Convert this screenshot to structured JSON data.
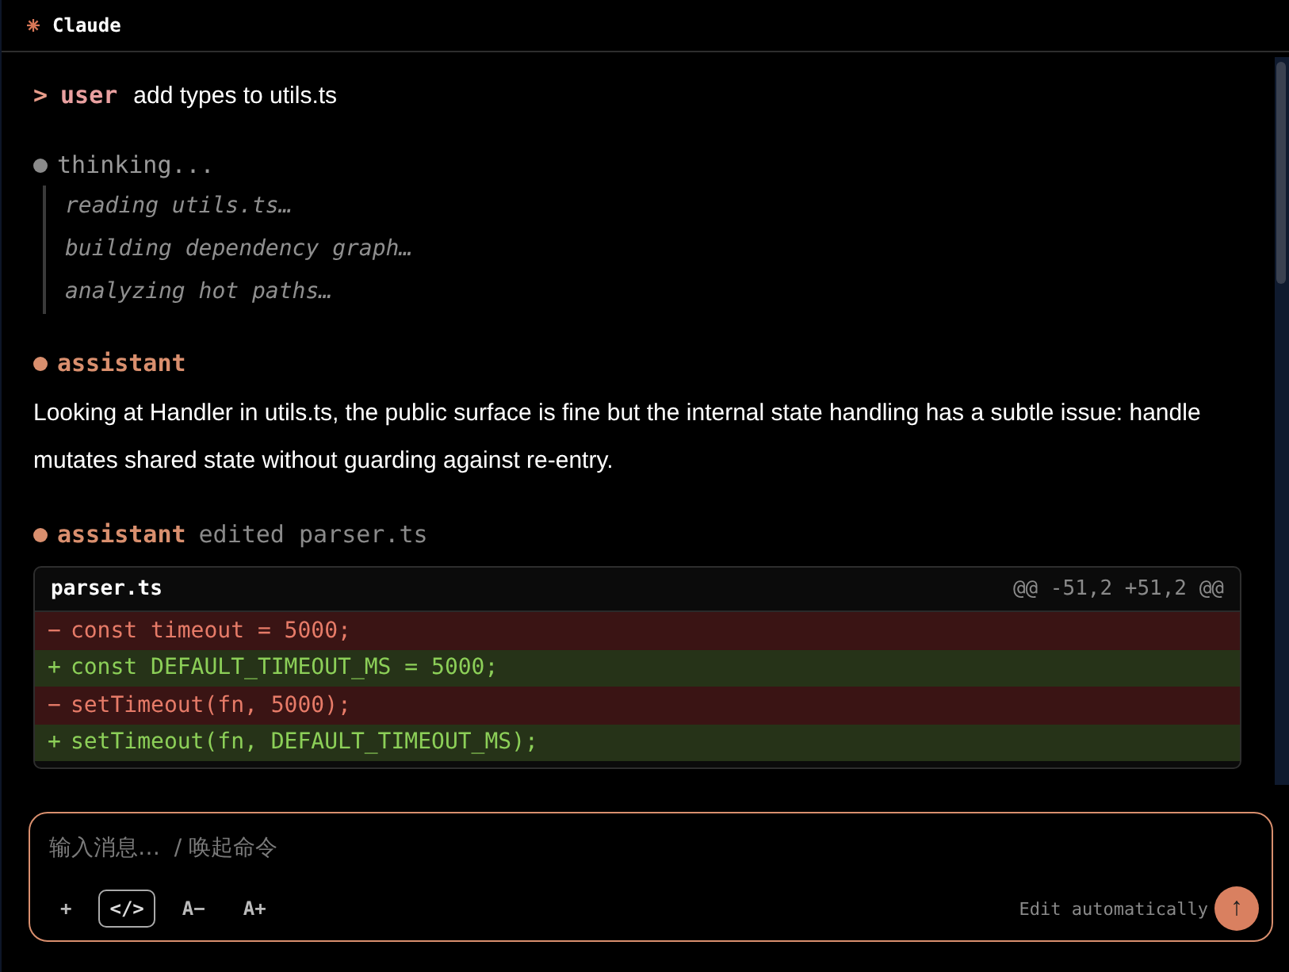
{
  "window": {
    "title": "Claude"
  },
  "messages": [
    {
      "kind": "user",
      "prompt": ">",
      "role": "user",
      "text": "add types to utils.ts"
    },
    {
      "kind": "thinking",
      "label": "thinking...",
      "steps": [
        "reading utils.ts…",
        "building dependency graph…",
        "analyzing hot paths…"
      ]
    },
    {
      "kind": "assistant",
      "role": "assistant",
      "text": "Looking at Handler in utils.ts, the public surface is fine but the internal state handling has a subtle issue: handle mutates shared state without guarding against re-entry."
    },
    {
      "kind": "edit",
      "role": "assistant",
      "action": "edited parser.ts",
      "diff": {
        "file": "parser.ts",
        "hunk": "@@ -51,2 +51,2 @@",
        "lines": [
          {
            "kind": "del",
            "sign": "−",
            "code": "const timeout = 5000;"
          },
          {
            "kind": "add",
            "sign": "+",
            "code": "const DEFAULT_TIMEOUT_MS = 5000;"
          },
          {
            "kind": "del",
            "sign": "−",
            "code": "setTimeout(fn, 5000);"
          },
          {
            "kind": "add",
            "sign": "+",
            "code": "setTimeout(fn, DEFAULT_TIMEOUT_MS);"
          }
        ]
      }
    }
  ],
  "composer": {
    "placeholder": "输入消息…  / 唤起命令",
    "tools": [
      {
        "label": "+",
        "selected": false
      },
      {
        "label": "</>",
        "selected": true
      },
      {
        "label": "A−",
        "selected": false
      },
      {
        "label": "A+",
        "selected": false
      }
    ],
    "mode": "Edit automatically",
    "send": "↑"
  }
}
